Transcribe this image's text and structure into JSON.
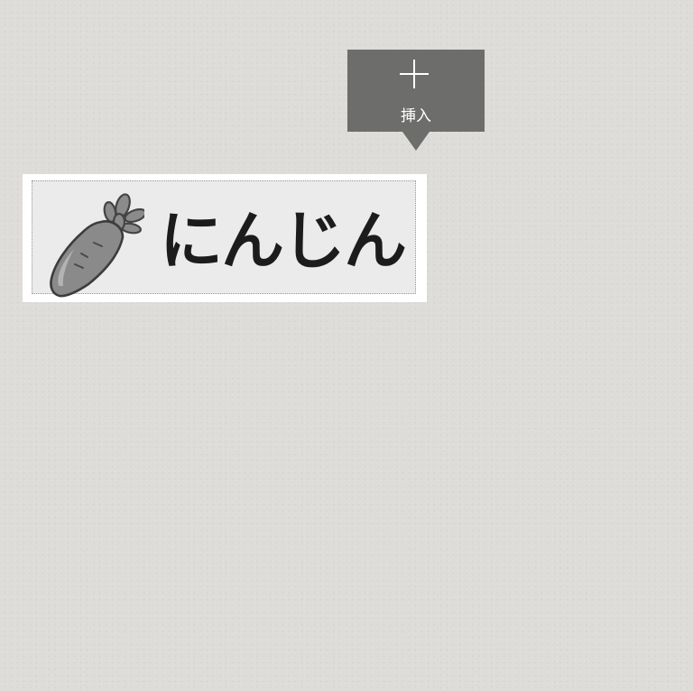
{
  "toolbar": {
    "insert_label": "挿入",
    "insert_icon": "plus-icon"
  },
  "label": {
    "text": "にんじん",
    "icon": "carrot-icon"
  },
  "colors": {
    "background": "#dedcd8",
    "tooltip": "#6d6d6b",
    "label_card": "#ffffff",
    "label_inner": "#ebebeb",
    "label_text": "#1c1c1c"
  }
}
